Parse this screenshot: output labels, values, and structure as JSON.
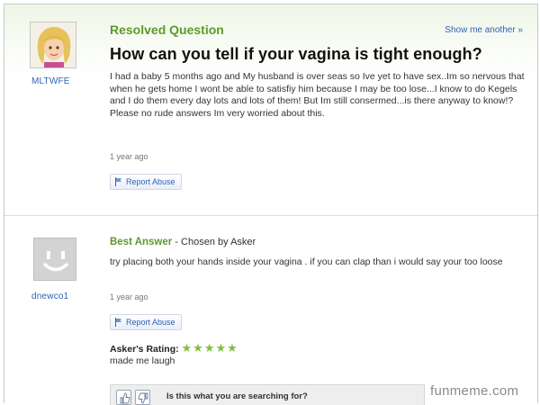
{
  "question": {
    "status": "Resolved Question",
    "show_another": "Show me another »",
    "title": "How can you tell if your vagina is tight enough?",
    "body": "I had a baby 5 months ago and My husband is over seas so Ive yet to have sex..Im so nervous that when he gets home I wont be able to satisfiy him because I may be too lose...I know to do Kegels and I do them every day lots and lots of them! But Im still consermed...is there anyway to know!? Please no rude answers Im very worried about this.",
    "time": "1 year ago",
    "report_label": "Report Abuse",
    "asker": {
      "username": "MLTWFE",
      "avatar_icon": "cartoon-avatar-icon"
    }
  },
  "answer": {
    "best_label": "Best Answer",
    "chosen_by": " - Chosen by Asker",
    "body": "try placing both your hands inside your vagina . if you can clap than i would say your too loose",
    "time": "1 year ago",
    "report_label": "Report Abuse",
    "answerer": {
      "username": "dnewco1",
      "avatar_icon": "default-smiley-avatar-icon"
    },
    "rating_label": "Asker's Rating:",
    "rating_stars": "★★★★★",
    "rating_value": 5,
    "rating_max": 5,
    "rating_comment": "made me laugh"
  },
  "search_prompt": {
    "question": "Is this what you are searching for?",
    "thumb_up_icon": "thumbs-up-icon",
    "thumb_down_icon": "thumbs-down-icon"
  },
  "watermark": "funmeme.com",
  "colors": {
    "accent_green": "#5c9a2c",
    "star_green": "#7dc23a",
    "link_blue": "#2d62b8"
  }
}
